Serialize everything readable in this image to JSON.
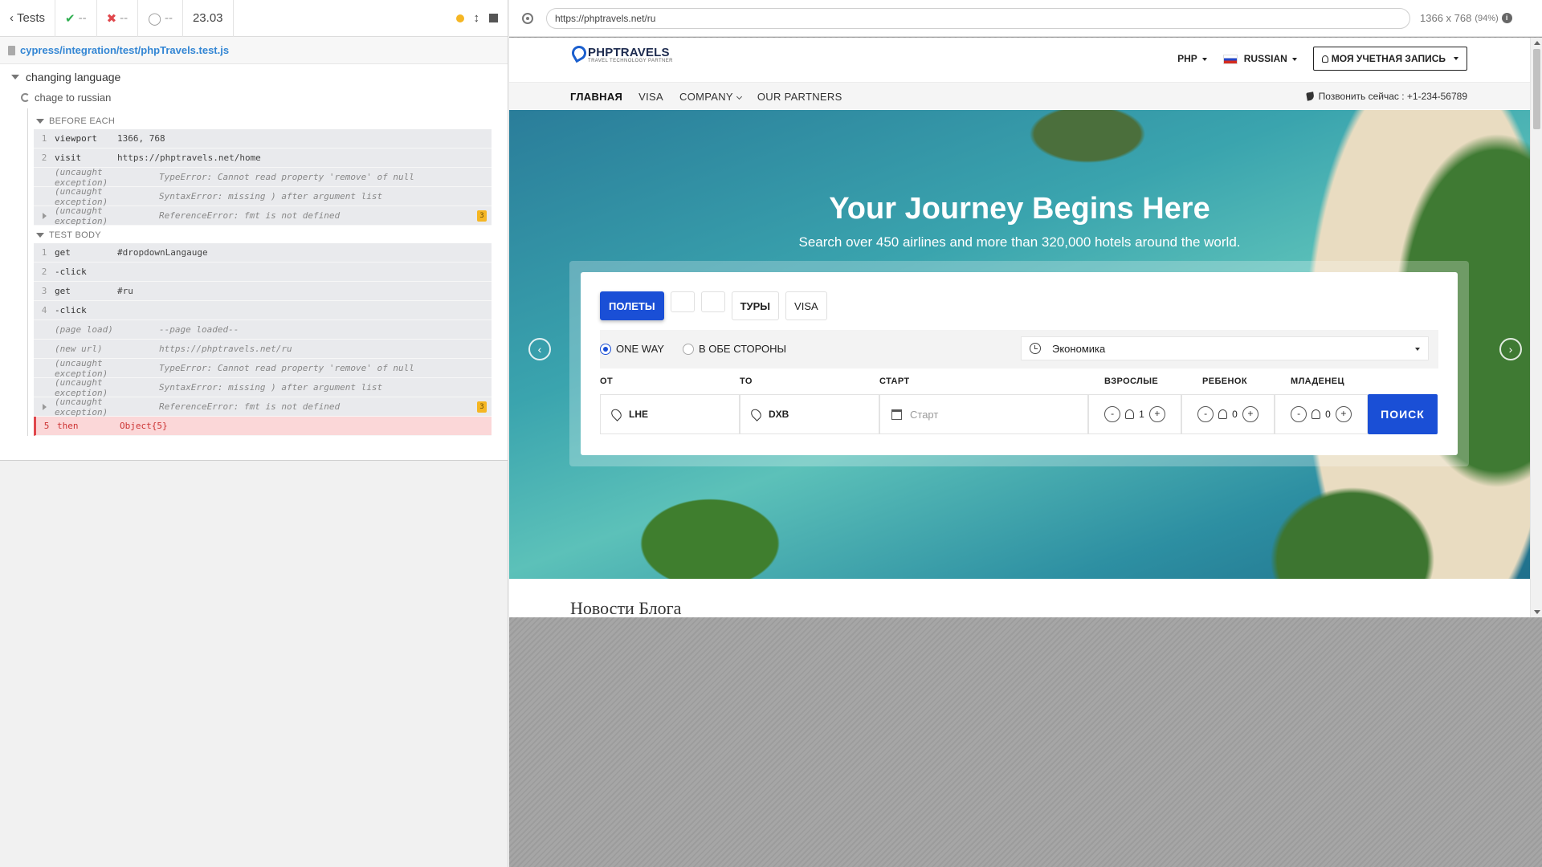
{
  "runner": {
    "back_label": "Tests",
    "passed": "--",
    "failed": "--",
    "pending": "--",
    "duration": "23.03",
    "spec_path": "cypress/integration/test/phpTravels.test.js",
    "suite_title": "changing language",
    "test_title": "chage to russian",
    "before_each_label": "BEFORE EACH",
    "test_body_label": "TEST BODY",
    "before_each": [
      {
        "num": "1",
        "name": "viewport",
        "msg": "1366, 768"
      },
      {
        "num": "2",
        "name": "visit",
        "msg": "https://phptravels.net/home"
      },
      {
        "num": "",
        "name": "(uncaught exception)",
        "msg": "TypeError: Cannot read property 'remove' of null"
      },
      {
        "num": "",
        "name": "(uncaught exception)",
        "msg": "SyntaxError: missing ) after argument list"
      },
      {
        "num": "",
        "name": "(uncaught exception)",
        "msg": "ReferenceError: fmt is not defined",
        "badge": "3"
      }
    ],
    "test_body": [
      {
        "num": "1",
        "name": "get",
        "msg": "#dropdownLangauge"
      },
      {
        "num": "2",
        "name": "-click",
        "msg": ""
      },
      {
        "num": "3",
        "name": "get",
        "msg": "#ru"
      },
      {
        "num": "4",
        "name": "-click",
        "msg": ""
      },
      {
        "num": "",
        "name": "(page load)",
        "msg": "--page loaded--"
      },
      {
        "num": "",
        "name": "(new url)",
        "msg": "https://phptravels.net/ru"
      },
      {
        "num": "",
        "name": "(uncaught exception)",
        "msg": "TypeError: Cannot read property 'remove' of null"
      },
      {
        "num": "",
        "name": "(uncaught exception)",
        "msg": "SyntaxError: missing ) after argument list"
      },
      {
        "num": "",
        "name": "(uncaught exception)",
        "msg": "ReferenceError: fmt is not defined",
        "badge": "3"
      },
      {
        "num": "5",
        "name": "then",
        "msg": "Object{5}"
      }
    ]
  },
  "aut": {
    "url": "https://phptravels.net/ru",
    "viewport_size": "1366 x 768",
    "viewport_scale": "(94%)"
  },
  "site": {
    "brand": "PHPTRAVELS",
    "tagline": "TRAVEL TECHNOLOGY PARTNER",
    "currency": "PHP",
    "language": "RUSSIAN",
    "account": "МОЯ УЧЕТНАЯ ЗАПИСЬ",
    "nav": [
      "ГЛАВНАЯ",
      "VISA",
      "COMPANY",
      "OUR PARTNERS"
    ],
    "phone": "Позвонить сейчас : +1-234-56789",
    "hero_title": "Your Journey Begins Here",
    "hero_subtitle": "Search over 450 airlines and more than 320,000 hotels around the world.",
    "tabs": {
      "flights": "ПОЛЕТЫ",
      "tours": "ТУРЫ",
      "visa": "VISA"
    },
    "trip_oneway": "ONE WAY",
    "trip_round": "В ОБЕ СТОРОНЫ",
    "cabin_class": "Экономика",
    "labels": {
      "from": "ОТ",
      "to": "ТО",
      "start": "СТАРТ",
      "adults": "ВЗРОСЛЫЕ",
      "child": "РЕБЕНОК",
      "infant": "МЛАДЕНЕЦ"
    },
    "from_value": "LHE",
    "to_value": "DXB",
    "date_placeholder": "Старт",
    "adults_count": "1",
    "child_count": "0",
    "infant_count": "0",
    "search_label": "ПОИСК",
    "blog_title": "Новости Блога"
  },
  "colors": {
    "accent": "#1a4fd6",
    "pass": "#2fae50",
    "fail": "#e0474c",
    "warning": "#f5b623"
  }
}
